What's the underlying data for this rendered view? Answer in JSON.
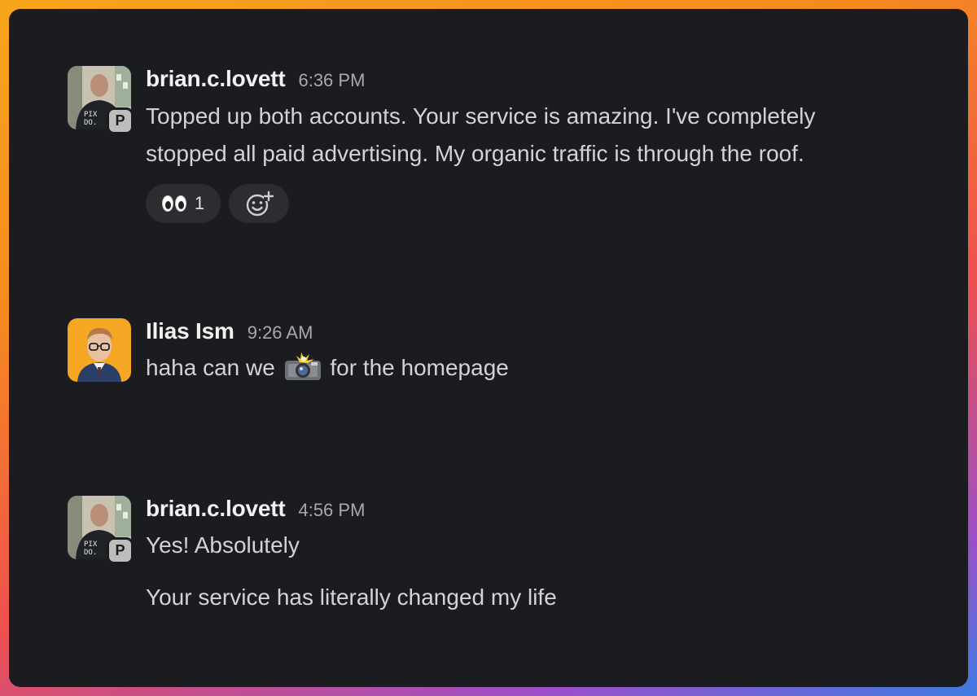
{
  "messages": [
    {
      "author": "brian.c.lovett",
      "time": "6:36 PM",
      "badge": "P",
      "lines": [
        "Topped up both accounts. Your service is amazing. I've completely",
        "stopped all paid advertising. My organic traffic is through the roof."
      ],
      "reactions": [
        {
          "emoji": "eyes-emoji",
          "count": "1"
        }
      ],
      "add_reaction_icon": "add-reaction-icon"
    },
    {
      "author": "Ilias Ism",
      "time": "9:26 AM",
      "text_before": "haha can we",
      "text_emoji": "camera-flash-emoji",
      "text_after": "for the homepage"
    },
    {
      "author": "brian.c.lovett",
      "time": "4:56 PM",
      "badge": "P",
      "lines": [
        "Yes! Absolutely"
      ],
      "second_paragraph": "Your service has literally changed my life"
    }
  ],
  "colors": {
    "card_background": "#1b1c1f",
    "author_text": "#f2f2f2",
    "body_text": "#d3d3d4",
    "timestamp_text": "#a9a9ab",
    "reaction_pill": "#2c2d30",
    "ilias_avatar_bg": "#f5a623"
  }
}
